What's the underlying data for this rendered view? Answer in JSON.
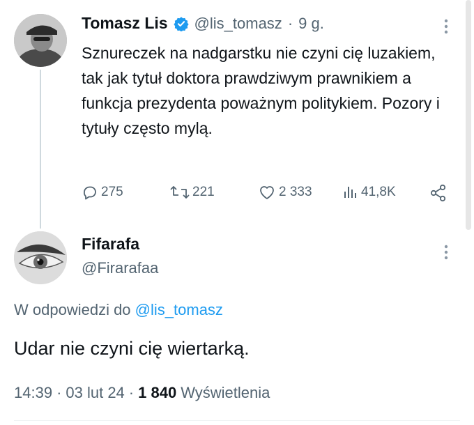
{
  "tweet": {
    "author_name": "Tomasz Lis",
    "author_handle": "@lis_tomasz",
    "separator": "·",
    "time_ago": "9 g.",
    "text": "Sznureczek na nadgarstku nie czyni cię luzakiem, tak jak tytuł doktora prawdziwym prawnikiem a funkcja prezydenta poważnym politykiem. Pozory i tytuły często mylą.",
    "replies": "275",
    "retweets": "221",
    "likes": "2 333",
    "views": "41,8K",
    "verified_color": "#1d9bf0"
  },
  "reply": {
    "author_name": "Fifarafa",
    "author_handle": "@Firarafaa",
    "in_reply_prefix": "W odpowiedzi do",
    "in_reply_handle": "@lis_tomasz",
    "text": "Udar nie czyni cię wiertarką.",
    "time": "14:39",
    "date": "03 lut 24",
    "separator": "·",
    "view_count": "1 840",
    "views_label": "Wyświetlenia"
  },
  "colors": {
    "accent": "#1d9bf0",
    "text": "#0f1419",
    "muted": "#536471"
  }
}
